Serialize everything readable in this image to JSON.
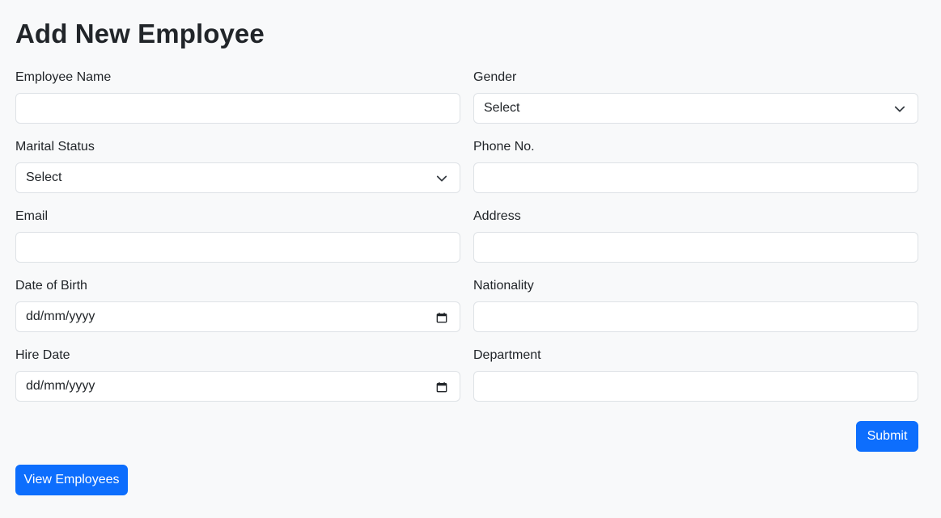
{
  "page": {
    "title": "Add New Employee"
  },
  "form": {
    "employee_name": {
      "label": "Employee Name",
      "value": ""
    },
    "gender": {
      "label": "Gender",
      "selected": "Select"
    },
    "marital_status": {
      "label": "Marital Status",
      "selected": "Select"
    },
    "phone": {
      "label": "Phone No.",
      "value": ""
    },
    "email": {
      "label": "Email",
      "value": ""
    },
    "address": {
      "label": "Address",
      "value": ""
    },
    "date_of_birth": {
      "label": "Date of Birth",
      "value": "dd/mm/yyyy"
    },
    "nationality": {
      "label": "Nationality",
      "value": ""
    },
    "hire_date": {
      "label": "Hire Date",
      "value": "dd/mm/yyyy"
    },
    "department": {
      "label": "Department",
      "value": ""
    }
  },
  "actions": {
    "submit_label": "Submit",
    "view_label": "View Employees"
  },
  "icons": {
    "select": "chevron-down-icon",
    "date": "calendar-icon"
  },
  "colors": {
    "accent": "#0d6efd",
    "background": "#f8f9fa",
    "border": "#dee2e6"
  }
}
